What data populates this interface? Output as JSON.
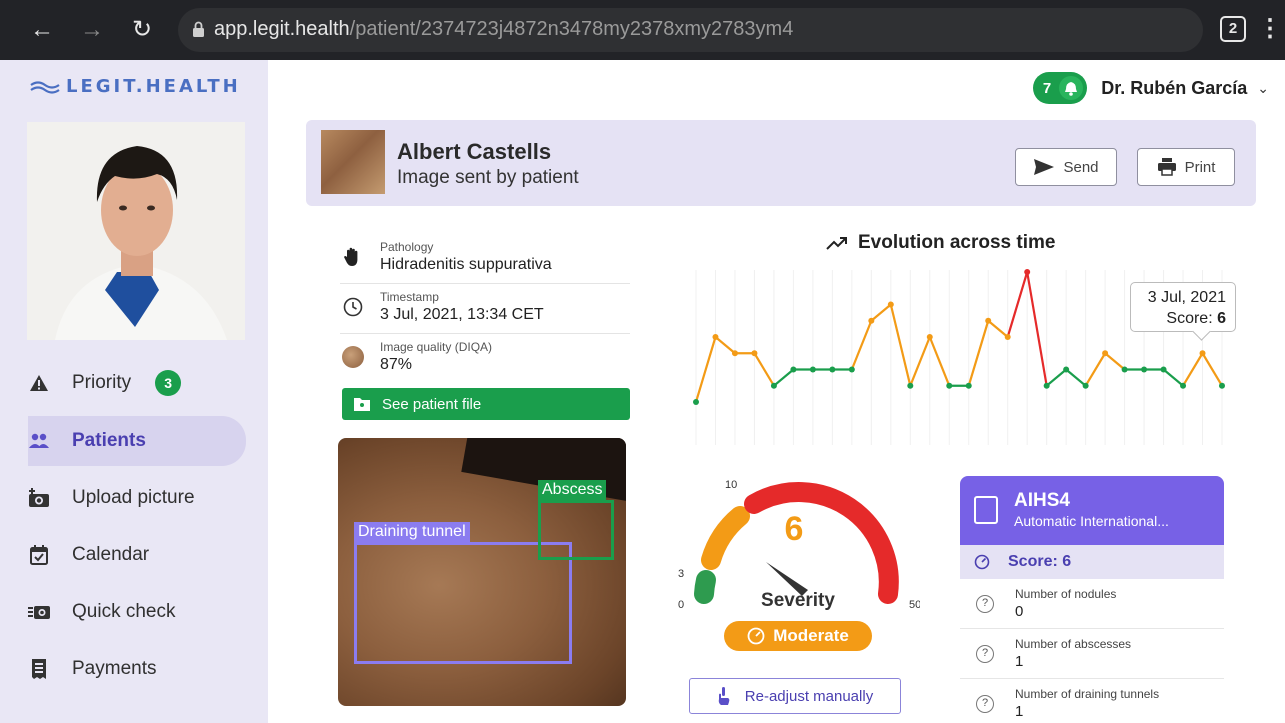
{
  "browser": {
    "url_domain": "app.legit.health",
    "url_path": "/patient/2374723j4872n3478my2378xmy2783ym4",
    "tab_count": "2"
  },
  "sidebar": {
    "logo_text": "LEGIT.HEALTH",
    "items": [
      {
        "label": "Priority",
        "icon": "warning-icon",
        "badge": "3"
      },
      {
        "label": "Patients",
        "icon": "patients-icon",
        "active": true
      },
      {
        "label": "Upload picture",
        "icon": "camera-plus-icon"
      },
      {
        "label": "Calendar",
        "icon": "calendar-icon"
      },
      {
        "label": "Quick check",
        "icon": "quick-camera-icon"
      },
      {
        "label": "Payments",
        "icon": "receipt-icon"
      }
    ]
  },
  "header": {
    "notification_count": "7",
    "doctor_name": "Dr. Rubén García"
  },
  "patient": {
    "name": "Albert Castells",
    "subtitle": "Image sent by patient",
    "send_label": "Send",
    "print_label": "Print"
  },
  "details": {
    "pathology_label": "Pathology",
    "pathology_value": "Hidradenitis suppurativa",
    "timestamp_label": "Timestamp",
    "timestamp_value": "3 Jul, 2021, 13:34 CET",
    "quality_label": "Image quality (DIQA)",
    "quality_value": "87%",
    "see_file_label": "See patient file"
  },
  "detections": {
    "draining_tunnel": "Draining tunnel",
    "abscess": "Abscess"
  },
  "colors": {
    "accent": "#7761e6",
    "green": "#1a9e4c",
    "orange": "#f39b16",
    "red": "#e52a2a"
  },
  "chart_data": {
    "type": "line",
    "title": "Evolution across time",
    "y_note": "severity score per capture (approximate)",
    "values": [
      1,
      5,
      4,
      4,
      2,
      3,
      3,
      3,
      3,
      6,
      7,
      2,
      5,
      2,
      2,
      6,
      5,
      9,
      2,
      3,
      2,
      4,
      3,
      3,
      3,
      2,
      4,
      2
    ],
    "tooltip": {
      "date": "3 Jul, 2021",
      "score_label": "Score:",
      "score": "6"
    }
  },
  "severity": {
    "score": "6",
    "label": "Severity",
    "level": "Moderate",
    "ticks": {
      "t0": "0",
      "t3": "3",
      "t10": "10",
      "t50": "50"
    },
    "readjust_label": "Re-adjust manually"
  },
  "aihs": {
    "title": "AIHS4",
    "subtitle": "Automatic International...",
    "score_label": "Score: 6",
    "rows": [
      {
        "label": "Number of nodules",
        "value": "0"
      },
      {
        "label": "Number of abscesses",
        "value": "1"
      },
      {
        "label": "Number of draining tunnels",
        "value": "1"
      }
    ]
  }
}
